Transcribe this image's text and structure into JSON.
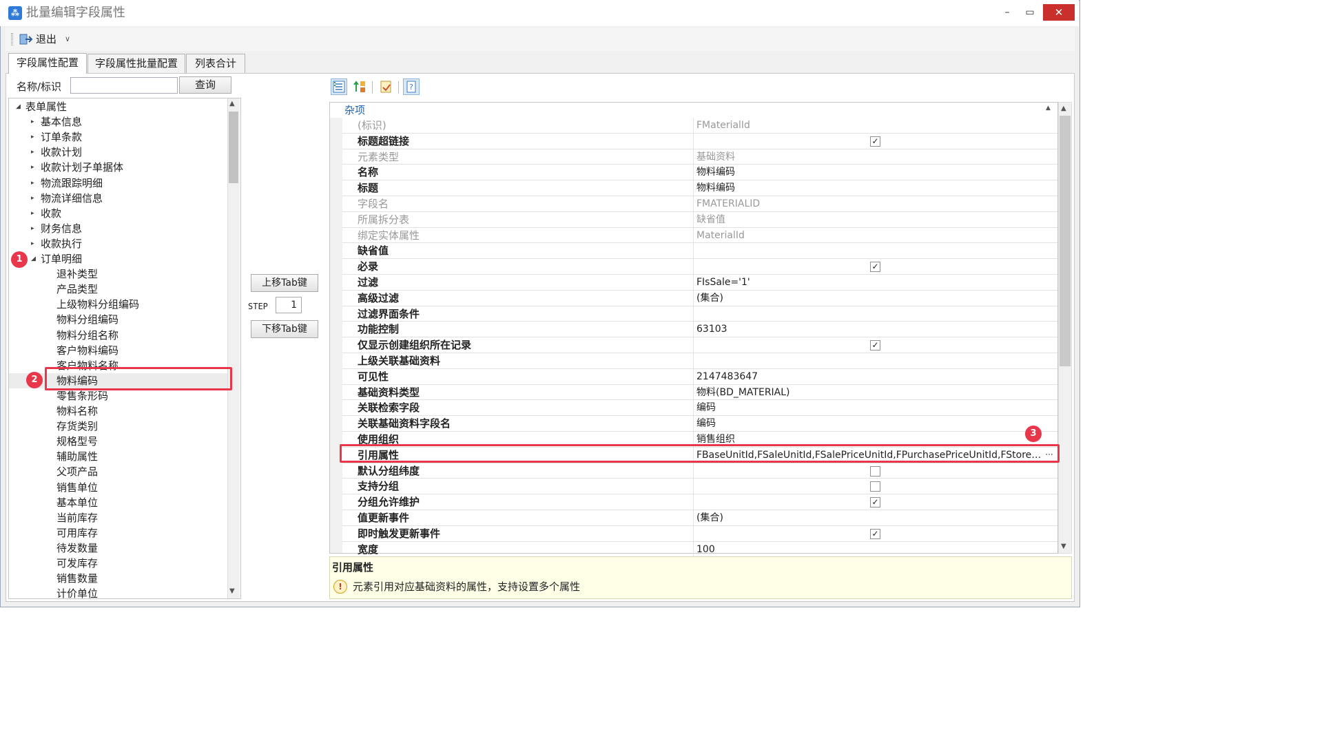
{
  "window": {
    "title": "批量编辑字段属性",
    "minimize": "–",
    "maximize": "▭",
    "close": "✕"
  },
  "toolbar": {
    "exit_label": "退出"
  },
  "tabs": [
    {
      "label": "字段属性配置",
      "active": true
    },
    {
      "label": "字段属性批量配置",
      "active": false
    },
    {
      "label": "列表合计",
      "active": false
    }
  ],
  "search": {
    "label": "名称/标识",
    "value": "",
    "button": "查询"
  },
  "tree": {
    "root": "表单属性",
    "groups": [
      "基本信息",
      "订单条款",
      "收款计划",
      "收款计划子单据体",
      "物流跟踪明细",
      "物流详细信息",
      "收款",
      "财务信息",
      "收款执行"
    ],
    "expanded_group": "订单明细",
    "children": [
      "退补类型",
      "产品类型",
      "上级物料分组编码",
      "物料分组编码",
      "物料分组名称",
      "客户物料编码",
      "客户物料名称",
      "物料编码",
      "零售条形码",
      "物料名称",
      "存货类别",
      "规格型号",
      "辅助属性",
      "父项产品",
      "销售单位",
      "基本单位",
      "当前库存",
      "可用库存",
      "待发数量",
      "可发库存",
      "销售数量",
      "计价单位"
    ],
    "selected": "物料编码"
  },
  "markers": {
    "m1": "1",
    "m2": "2",
    "m3": "3"
  },
  "middle": {
    "move_up": "上移Tab键",
    "step_label": "STEP",
    "step_value": "1",
    "move_down": "下移Tab键"
  },
  "grid": {
    "category": "杂项",
    "rows": [
      {
        "name": "(标识)",
        "value": "FMaterialId",
        "readonly": true
      },
      {
        "name": "标题超链接",
        "check": true
      },
      {
        "name": "元素类型",
        "value": "基础资料",
        "readonly": true
      },
      {
        "name": "名称",
        "value": "物料编码"
      },
      {
        "name": "标题",
        "value": "物料编码"
      },
      {
        "name": "字段名",
        "value": "FMATERIALID",
        "readonly": true
      },
      {
        "name": "所属拆分表",
        "value": "缺省值",
        "readonly": true
      },
      {
        "name": "绑定实体属性",
        "value": "MaterialId",
        "readonly": true
      },
      {
        "name": "缺省值",
        "value": ""
      },
      {
        "name": "必录",
        "check": true
      },
      {
        "name": "过滤",
        "value": "FIsSale='1'"
      },
      {
        "name": "高级过滤",
        "value": "(集合)"
      },
      {
        "name": "过滤界面条件",
        "value": ""
      },
      {
        "name": "功能控制",
        "value": "63103"
      },
      {
        "name": "仅显示创建组织所在记录",
        "check": true
      },
      {
        "name": "上级关联基础资料",
        "value": ""
      },
      {
        "name": "可见性",
        "value": "2147483647"
      },
      {
        "name": "基础资料类型",
        "value": "物料(BD_MATERIAL)"
      },
      {
        "name": "关联检索字段",
        "value": "编码"
      },
      {
        "name": "关联基础资料字段名",
        "value": "编码"
      },
      {
        "name": "使用组织",
        "value": "销售组织"
      },
      {
        "name": "引用属性",
        "value": "FBaseUnitId,FSaleUnitId,FSalePriceUnitId,FPurchasePriceUnitId,FStoreUni...",
        "highlight": true,
        "ellipsis": "···"
      },
      {
        "name": "默认分组纬度",
        "check": false
      },
      {
        "name": "支持分组",
        "check": false
      },
      {
        "name": "分组允许维护",
        "check": true
      },
      {
        "name": "值更新事件",
        "value": "(集合)"
      },
      {
        "name": "即时触发更新事件",
        "check": true
      },
      {
        "name": "宽度",
        "value": "100"
      }
    ]
  },
  "description": {
    "title": "引用属性",
    "text": "元素引用对应基础资料的属性，支持设置多个属性"
  },
  "colors": {
    "accent": "#2563b0",
    "marker": "#e8364a",
    "close": "#c9302c"
  }
}
